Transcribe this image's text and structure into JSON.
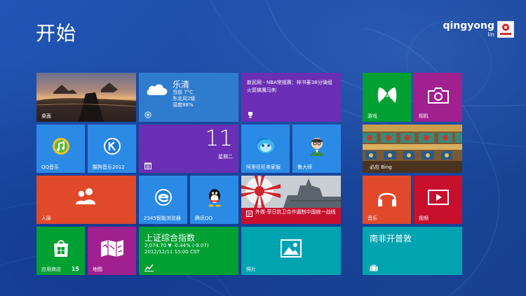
{
  "screen": {
    "title": "开始"
  },
  "user": {
    "first_name": "qingyong",
    "last_name": "lin"
  },
  "tiles": {
    "desktop": {
      "label": "桌面"
    },
    "weather": {
      "city": "乐清",
      "current": "当前 7°C",
      "wind": "东北风2级",
      "humidity": "湿度88%"
    },
    "news": {
      "text": "新民网 - NBA常规赛：林书豪38分骑组火箭擒鹰马刺"
    },
    "qq_music": {
      "label": "QQ音乐"
    },
    "kugou": {
      "label": "酷狗音乐2012"
    },
    "calendar": {
      "day_number": "11",
      "weekday": "星期二"
    },
    "aliwangwang": {
      "label": "阿里旺旺卖家版"
    },
    "ludashi": {
      "label": "鲁大师"
    },
    "people": {
      "label": "人脉"
    },
    "browser_2345": {
      "label": "2345智能浏览器"
    },
    "tencent_qq": {
      "label": "腾讯QQ"
    },
    "news_photo": {
      "text": "外媒-菲日防卫合作遏制中国统一战线"
    },
    "store": {
      "label": "应用商店",
      "badge": "15"
    },
    "maps": {
      "label": "地图"
    },
    "stock": {
      "title": "上证综合指数",
      "value": "2,074.70 ▼ -0.44% (-9.07)",
      "time": "2012/12/11 15:00 CST"
    },
    "photos": {
      "label": "照片"
    },
    "games": {
      "label": "游戏"
    },
    "camera": {
      "label": "相机"
    },
    "bing": {
      "label": "必应 Bing"
    },
    "music": {
      "label": "音乐"
    },
    "video": {
      "label": "视频"
    },
    "travel": {
      "title": "南非开普敦"
    }
  },
  "colors": {
    "background": "#1c4fa8",
    "green": "#00a032",
    "blue": "#2b8ae6",
    "purple": "#6b2fb5",
    "orange_red": "#e04a2b",
    "magenta": "#a0208f",
    "teal": "#00a3b0",
    "weather_blue": "#2f7ccf"
  }
}
